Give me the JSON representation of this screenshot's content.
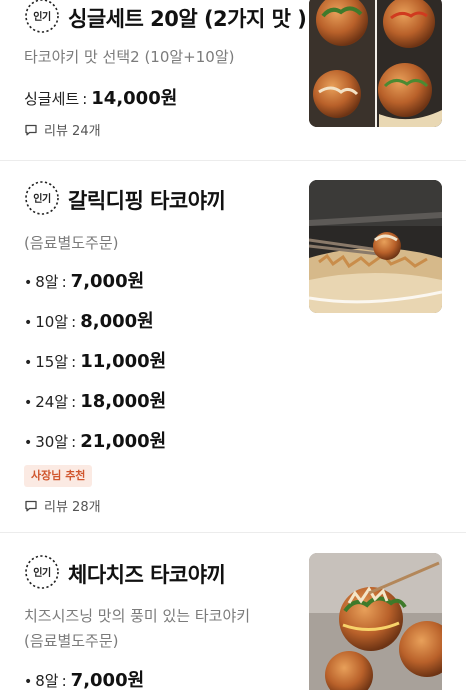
{
  "badge_label": "인기",
  "items": [
    {
      "title": "싱글세트 20알 (2가지 맛 )",
      "desc": "타코야키 맛 선택2 (10알+10알)",
      "prices": [
        {
          "label": "싱글세트",
          "value": "14,000원"
        }
      ],
      "review": "리뷰 24개",
      "thumb_icon": "takoyaki-set-photo"
    },
    {
      "title": "갈릭디핑 타코야끼",
      "desc": "(음료별도주문)",
      "prices": [
        {
          "bullet": "•",
          "label": "8알",
          "value": "7,000원"
        },
        {
          "bullet": "•",
          "label": "10알",
          "value": "8,000원"
        },
        {
          "bullet": "•",
          "label": "15알",
          "value": "11,000원"
        },
        {
          "bullet": "•",
          "label": "24알",
          "value": "18,000원"
        },
        {
          "bullet": "•",
          "label": "30알",
          "value": "21,000원"
        }
      ],
      "owner_badge": "사장님 추천",
      "review": "리뷰 28개",
      "thumb_icon": "garlic-takoyaki-photo"
    },
    {
      "title": "체다치즈 타코야끼",
      "desc": "치즈시즈닝 맛의 풍미 있는 타코야키",
      "desc2": "(음료별도주문)",
      "prices": [
        {
          "bullet": "•",
          "label": "8알",
          "value": "7,000원"
        }
      ],
      "thumb_icon": "cheddar-takoyaki-photo"
    }
  ],
  "colors": {
    "accent_badge_bg": "#fbeae3",
    "accent_badge_text": "#d0562e",
    "muted_text": "#7b7b7b"
  }
}
